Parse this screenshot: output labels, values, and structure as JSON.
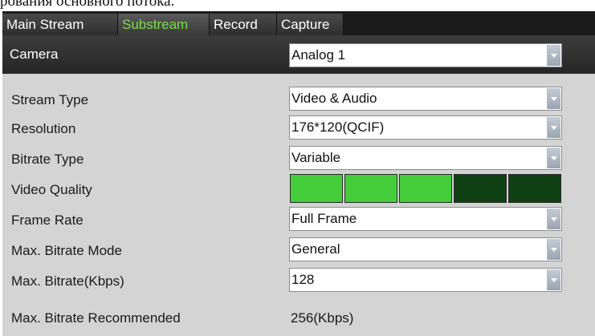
{
  "caption": "рования основного потока.",
  "tabs": [
    {
      "label": "Main Stream",
      "active": false
    },
    {
      "label": "Substream",
      "active": true
    },
    {
      "label": "Record",
      "active": false
    },
    {
      "label": "Capture",
      "active": false
    }
  ],
  "camera": {
    "label": "Camera",
    "value": "Analog 1"
  },
  "fields": {
    "stream_type": {
      "label": "Stream Type",
      "value": "Video & Audio"
    },
    "resolution": {
      "label": "Resolution",
      "value": "176*120(QCIF)"
    },
    "bitrate_type": {
      "label": "Bitrate Type",
      "value": "Variable"
    },
    "video_quality": {
      "label": "Video Quality",
      "level": 3,
      "max": 5,
      "on_color": "#44cc3a",
      "off_color": "#0e4014"
    },
    "frame_rate": {
      "label": "Frame Rate",
      "value": "Full Frame"
    },
    "max_bitrate_mode": {
      "label": "Max. Bitrate Mode",
      "value": "General"
    },
    "max_bitrate": {
      "label": "Max. Bitrate(Kbps)",
      "value": "128"
    },
    "max_bitrate_recommended": {
      "label": "Max. Bitrate Recommended",
      "value": "256(Kbps)"
    }
  },
  "colors": {
    "active_tab_text": "#7ddc4b",
    "panel_bg": "#d4d4d4",
    "header_bg": "#2e2e2e"
  }
}
